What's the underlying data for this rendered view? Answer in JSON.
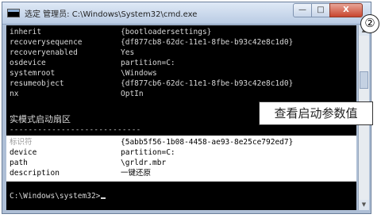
{
  "window": {
    "title": "选定 管理员: C:\\Windows\\System32\\cmd.exe",
    "close_label": "X"
  },
  "console_top": [
    {
      "key": "inherit",
      "value": "{bootloadersettings}"
    },
    {
      "key": "recoverysequence",
      "value": "{df877cb8-62dc-11e1-8fbe-b93c42e8c1d0}"
    },
    {
      "key": "recoveryenabled",
      "value": "Yes"
    },
    {
      "key": "osdevice",
      "value": "partition=C:"
    },
    {
      "key": "systemroot",
      "value": "\\Windows"
    },
    {
      "key": "resumeobject",
      "value": "{df877cb6-62dc-11e1-8fbe-b93c42e8c1d0}"
    },
    {
      "key": "nx",
      "value": "OptIn"
    }
  ],
  "section_title": "实模式启动扇区",
  "section_rule": "----------------------------",
  "highlight_entries": [
    {
      "key": "标识符",
      "value": "{5abb5f56-1b08-4458-ae93-8e25ce792ed7}"
    },
    {
      "key": "device",
      "value": "partition=C:"
    },
    {
      "key": "path",
      "value": "\\grldr.mbr"
    },
    {
      "key": "description",
      "value": "一键还原"
    }
  ],
  "prompt": "C:\\Windows\\system32>",
  "callout": "查看启动参数值",
  "badge": "②"
}
